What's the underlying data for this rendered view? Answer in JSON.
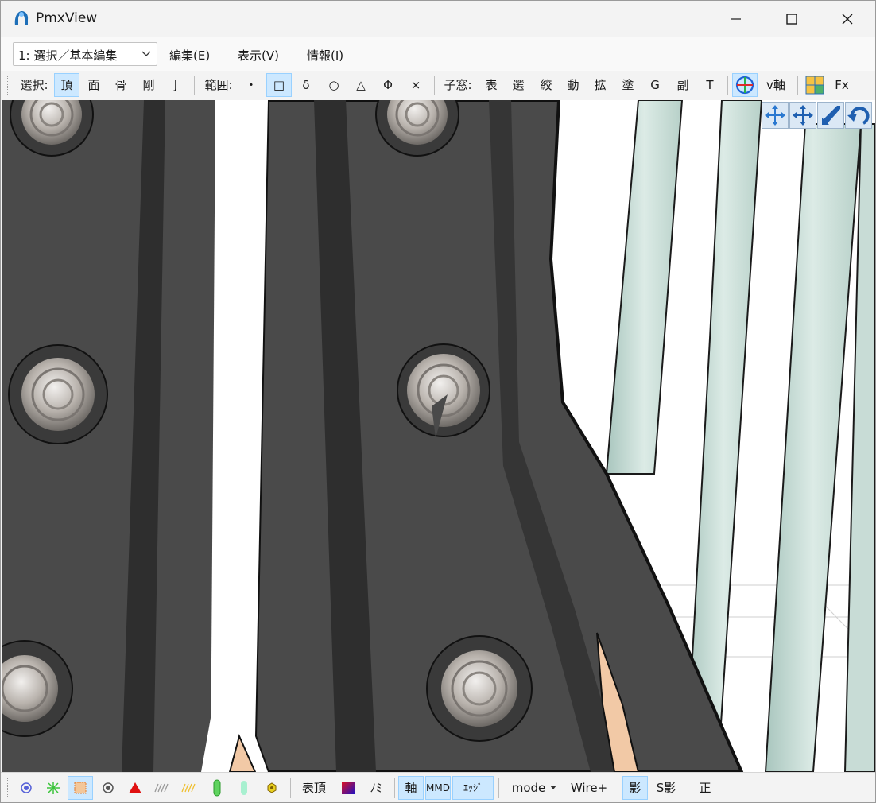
{
  "window": {
    "title": "PmxView"
  },
  "menubar": {
    "mode_value": "1: 選択／基本編集",
    "items": [
      "編集(E)",
      "表示(V)",
      "情報(I)"
    ]
  },
  "toolbar": {
    "select_label": "選択:",
    "select_buttons": [
      "頂",
      "面",
      "骨",
      "剛",
      "J"
    ],
    "range_label": "範囲:",
    "range_buttons": [
      "・",
      "□",
      "δ",
      "○",
      "△",
      "Φ",
      "×"
    ],
    "child_label": "子窓:",
    "child_buttons": [
      "表",
      "選",
      "絞",
      "動",
      "拡",
      "塗",
      "G",
      "副",
      "T"
    ],
    "v_axis": "v軸",
    "fx": "Fx"
  },
  "statusbar": {
    "hyouchou": "表頂",
    "nomi": "ﾉﾐ",
    "axis": "軸",
    "mmd": "MMD",
    "edge": "ｴｯｼﾞ",
    "mode": "mode",
    "wire": "Wire+",
    "shadow": "影",
    "sshadow": "S影",
    "sei": "正"
  },
  "colors": {
    "accent_active": "#cce8ff",
    "accent_border": "#99d1ff",
    "model_dark": "#4a4a4a",
    "model_rail": "#c8dcd6"
  }
}
